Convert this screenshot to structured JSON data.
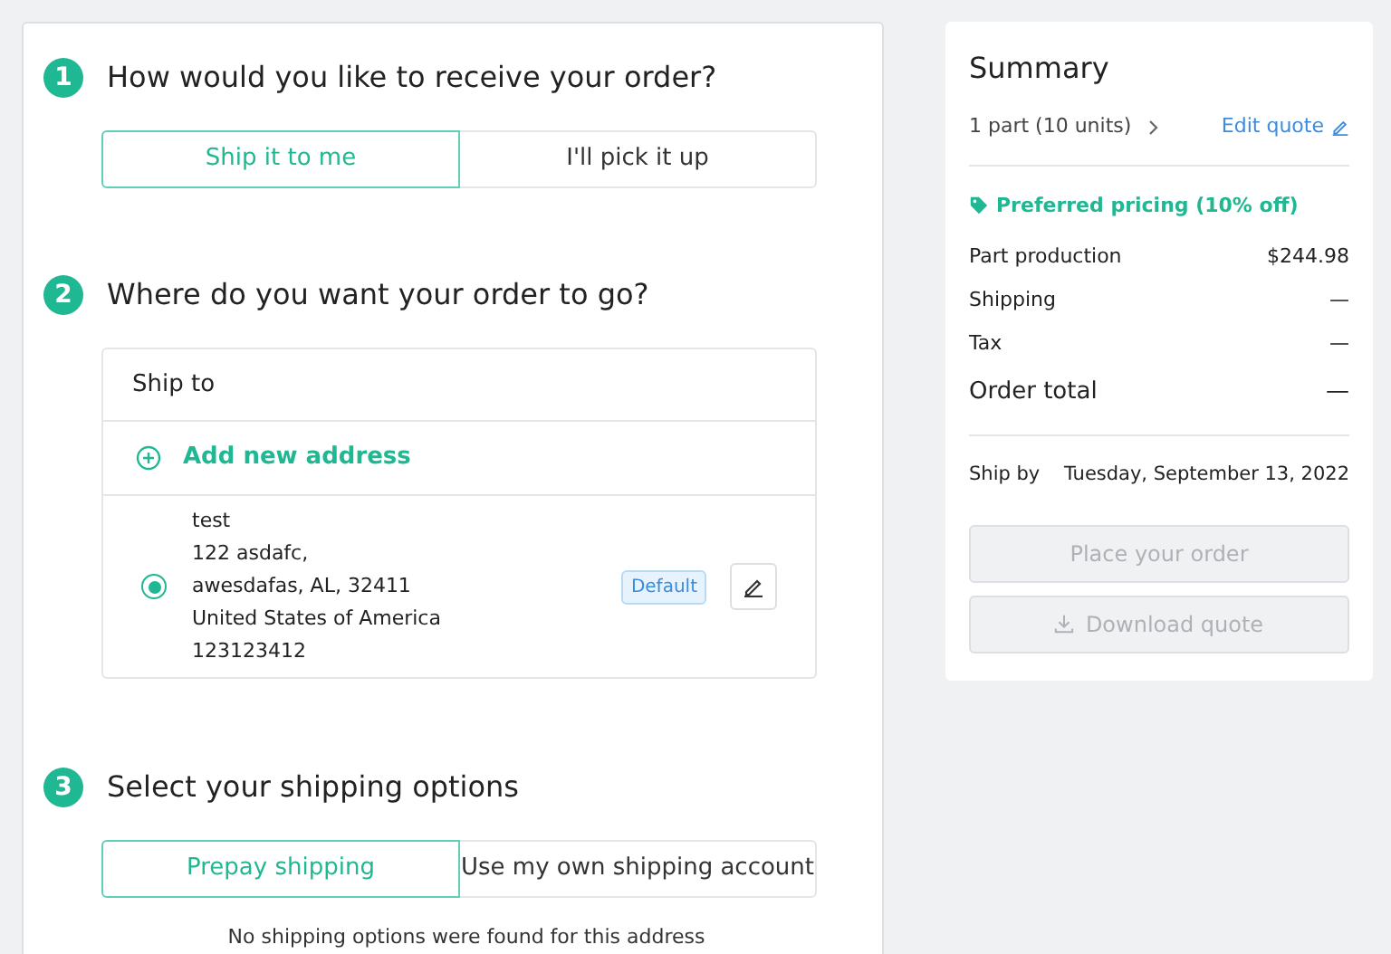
{
  "steps": [
    {
      "number": "1",
      "title": "How would you like to receive your order?",
      "options": [
        {
          "label": "Ship it to me",
          "selected": true
        },
        {
          "label": "I'll pick it up",
          "selected": false
        }
      ]
    },
    {
      "number": "2",
      "title": "Where do you want your order to go?",
      "ship_to": {
        "heading": "Ship to",
        "add_link": "Add new address",
        "addresses": [
          {
            "selected": true,
            "lines": [
              "test",
              "122 asdafc,",
              "awesdafas, AL, 32411",
              "United States of America",
              "123123412"
            ],
            "badge": "Default"
          }
        ]
      }
    },
    {
      "number": "3",
      "title": "Select your shipping options",
      "options": [
        {
          "label": "Prepay shipping",
          "selected": true
        },
        {
          "label": "Use my own shipping account",
          "selected": false
        }
      ],
      "note": "No shipping options were found for this address"
    }
  ],
  "summary": {
    "title": "Summary",
    "parts": "1 part (10 units)",
    "edit_link": "Edit quote",
    "promo": "Preferred pricing (10% off)",
    "lines": [
      {
        "label": "Part production",
        "value": "$244.98",
        "kind": "normal"
      },
      {
        "label": "Shipping",
        "value": "—",
        "kind": "normal"
      },
      {
        "label": "Tax",
        "value": "—",
        "kind": "normal"
      },
      {
        "label": "Order total",
        "value": "—",
        "kind": "total"
      }
    ],
    "ship_by": {
      "label": "Ship by",
      "value": "Tuesday, September 13, 2022"
    },
    "buttons": [
      {
        "label": "Place your order",
        "disabled": true,
        "kind": "plain"
      },
      {
        "label": "Download quote",
        "disabled": true,
        "kind": "download"
      }
    ]
  }
}
